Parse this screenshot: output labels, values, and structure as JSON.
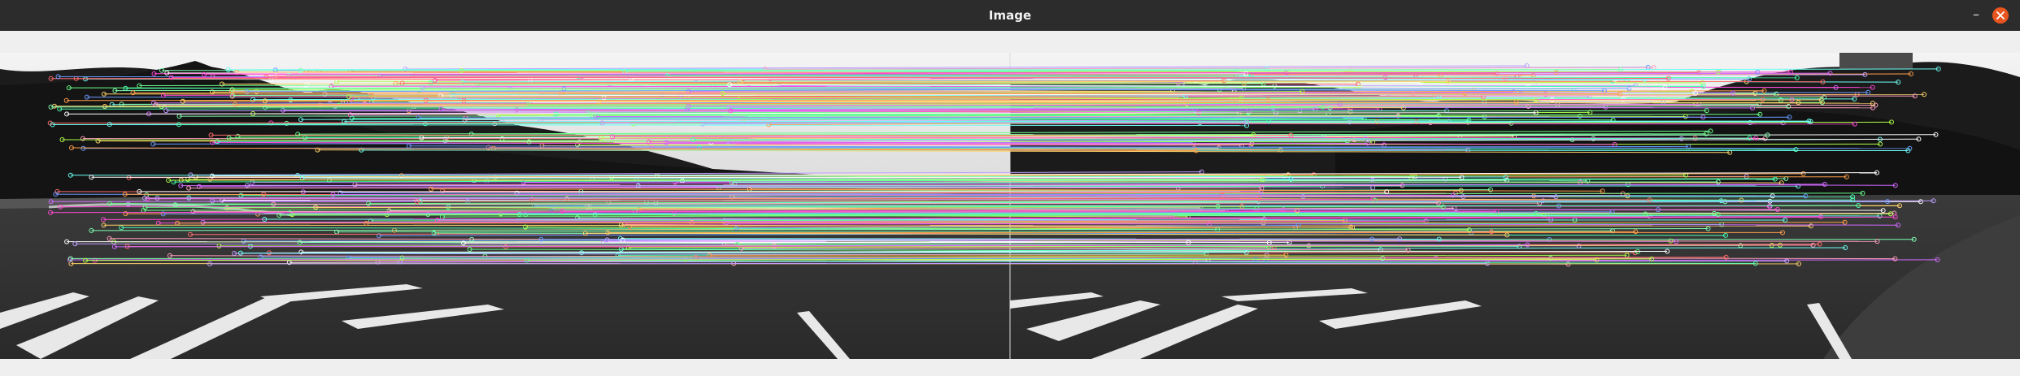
{
  "window": {
    "title": "Image",
    "minimize_glyph": "–",
    "minimize_icon": "minimize-icon",
    "close_icon": "close-icon",
    "close_color": "#e9541f"
  },
  "image": {
    "left_panel_icon": "camera-frame-left",
    "right_panel_icon": "camera-frame-right",
    "colors": [
      "#ff6b6b",
      "#6bff8a",
      "#6b9bff",
      "#ffd36b",
      "#d36bff",
      "#6bfff4",
      "#ff9e4a",
      "#b0ff4a",
      "#ff4ad6",
      "#4affb0",
      "#ffffff",
      "#c0a0ff",
      "#80ffb0",
      "#ffa0c0"
    ]
  }
}
